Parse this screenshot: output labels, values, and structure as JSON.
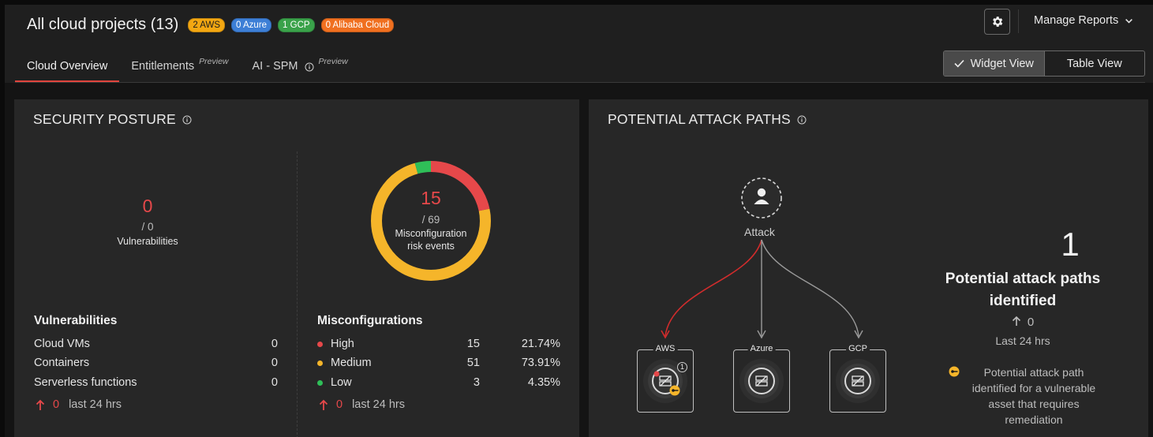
{
  "header": {
    "title": "All cloud projects (13)",
    "badges": {
      "aws": "2 AWS",
      "azure": "0 Azure",
      "gcp": "1 GCP",
      "alibaba": "0 Alibaba Cloud"
    },
    "manage_reports": "Manage Reports"
  },
  "tabs": [
    {
      "label": "Cloud Overview",
      "active": true
    },
    {
      "label": "Entitlements",
      "tag": "Preview"
    },
    {
      "label": "AI - SPM",
      "tag": "Preview"
    }
  ],
  "view_toggle": {
    "widget": "Widget View",
    "table": "Table View",
    "selected": "Widget View"
  },
  "security_posture": {
    "title": "SECURITY POSTURE",
    "vuln_summary": {
      "count": "0",
      "total": "/ 0",
      "label": "Vulnerabilities"
    },
    "misconfig_summary": {
      "count": "15",
      "total": "/ 69",
      "label_1": "Misconfiguration",
      "label_2": "risk events"
    },
    "vulnerabilities": {
      "heading": "Vulnerabilities",
      "rows": [
        {
          "label": "Cloud VMs",
          "value": "0"
        },
        {
          "label": "Containers",
          "value": "0"
        },
        {
          "label": "Serverless functions",
          "value": "0"
        }
      ],
      "delta": "0",
      "delta_label": "last 24 hrs"
    },
    "misconfigurations": {
      "heading": "Misconfigurations",
      "rows": [
        {
          "label": "High",
          "count": "15",
          "percent": "21.74%",
          "color": "#e6484a"
        },
        {
          "label": "Medium",
          "count": "51",
          "percent": "73.91%",
          "color": "#f5b52a"
        },
        {
          "label": "Low",
          "count": "3",
          "percent": "4.35%",
          "color": "#2fbf58"
        }
      ],
      "delta": "0",
      "delta_label": "last 24 hrs"
    },
    "donut_fractions": {
      "high": 0.2174,
      "medium": 0.7391,
      "low": 0.0435
    }
  },
  "attack_paths": {
    "title": "POTENTIAL ATTACK PATHS",
    "source_label": "Attack",
    "nodes": [
      {
        "label": "AWS",
        "alert_count": "1",
        "active": true
      },
      {
        "label": "Azure"
      },
      {
        "label": "GCP"
      }
    ],
    "count": "1",
    "summary_line1": "Potential attack paths",
    "summary_line2": "identified",
    "delta": "0",
    "delta_label": "Last 24 hrs",
    "legend_text": "Potential attack path identified for a vulnerable asset that requires remediation"
  },
  "colors": {
    "accent_red": "#e0443d",
    "medium_yellow": "#f5b52a",
    "low_green": "#2fbf58"
  }
}
